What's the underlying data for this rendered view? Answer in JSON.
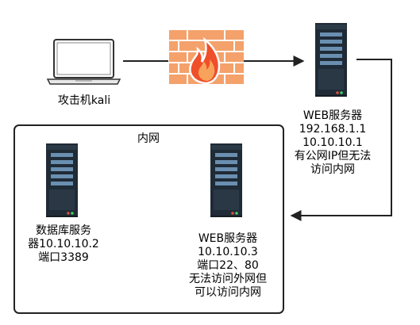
{
  "attacker": {
    "label": "攻击机kali"
  },
  "web_server_public": {
    "lines": [
      "WEB服务器",
      "192.168.1.1",
      "10.10.10.1",
      "有公网IP但无法",
      "访问内网"
    ]
  },
  "intranet": {
    "title": "内网",
    "db_server": {
      "lines": [
        "数据库服务",
        "器10.10.10.2",
        "端口3389"
      ]
    },
    "web_server_internal": {
      "lines": [
        "WEB服务器",
        "10.10.10.3",
        "端口22、80",
        "无法访问外网但",
        "可以访问内网"
      ]
    }
  },
  "colors": {
    "server_body": "#1f2b36",
    "server_bay": "#6a8fb0",
    "firewall_brick": "#f4a16b",
    "firewall_mortar": "#ffffff",
    "flame": "#ef4f2a",
    "line": "#222222"
  }
}
